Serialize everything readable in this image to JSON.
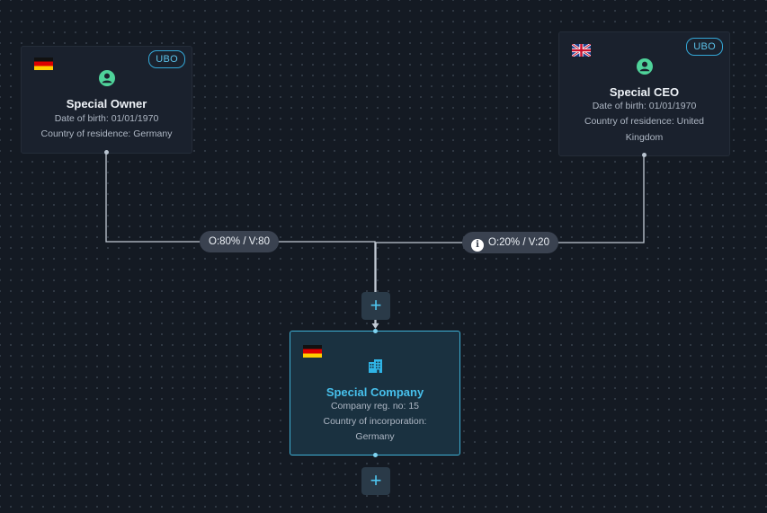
{
  "nodes": {
    "owner": {
      "badge": "UBO",
      "name": "Special Owner",
      "dob": "Date of birth: 01/01/1970",
      "residence": "Country of residence: Germany",
      "flag": "germany-flag",
      "icon": "person-icon"
    },
    "ceo": {
      "badge": "UBO",
      "name": "Special CEO",
      "dob": "Date of birth: 01/01/1970",
      "residence_line1": "Country of residence: United",
      "residence_line2": "Kingdom",
      "flag": "uk-flag",
      "icon": "person-icon"
    },
    "company": {
      "name": "Special Company",
      "reg": "Company reg. no: 15",
      "incorporation_line1": "Country of incorporation:",
      "incorporation_line2": "Germany",
      "flag": "germany-flag",
      "icon": "building-icon"
    }
  },
  "edges": {
    "owner_edge": "O:80% / V:80",
    "ceo_edge": "O:20% / V:20"
  },
  "buttons": {
    "add_symbol": "+"
  },
  "colors": {
    "background": "#141a23",
    "card": "#1a212d",
    "company_card": "#1a3140",
    "accent": "#3fb1d6",
    "person_icon": "#4fd39a",
    "edge_label_bg": "#3a4250"
  }
}
